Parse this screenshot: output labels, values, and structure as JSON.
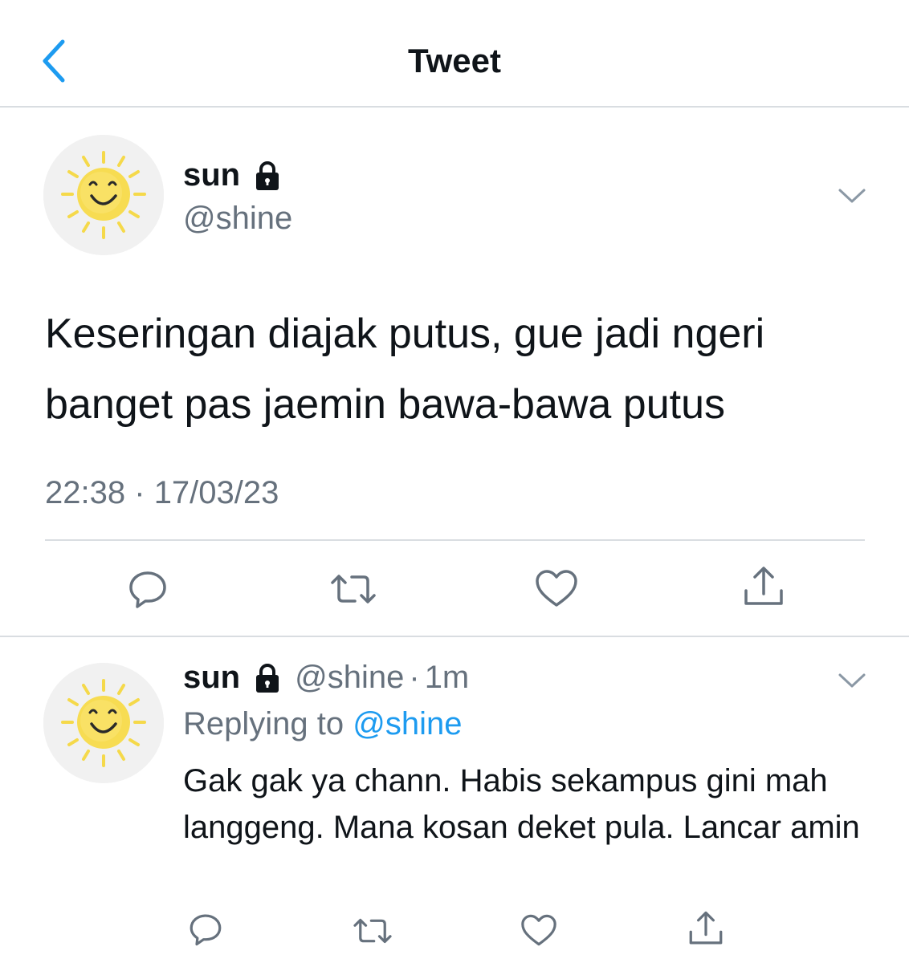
{
  "header": {
    "title": "Tweet"
  },
  "tweet": {
    "name": "sun",
    "handle": "@shine",
    "text": "Keseringan diajak putus, gue jadi ngeri banget pas jaemin bawa-bawa putus",
    "time": "22:38",
    "separator": "·",
    "date": "17/03/23"
  },
  "reply": {
    "name": "sun",
    "handle": "@shine",
    "separator": "·",
    "time_ago": "1m",
    "replying_prefix": "Replying to",
    "replying_to": "@shine",
    "text": "Gak gak ya chann. Habis sekampus gini mah langgeng. Mana kosan deket pula. Lancar amin"
  },
  "colors": {
    "accent": "#1d9bf0",
    "secondary_text": "#66717d",
    "divider": "#d9dde1",
    "icon": "#66717d"
  },
  "icons": [
    "back-chevron-icon",
    "lock-icon",
    "chevron-down-icon",
    "reply-icon",
    "retweet-icon",
    "like-icon",
    "share-icon"
  ]
}
